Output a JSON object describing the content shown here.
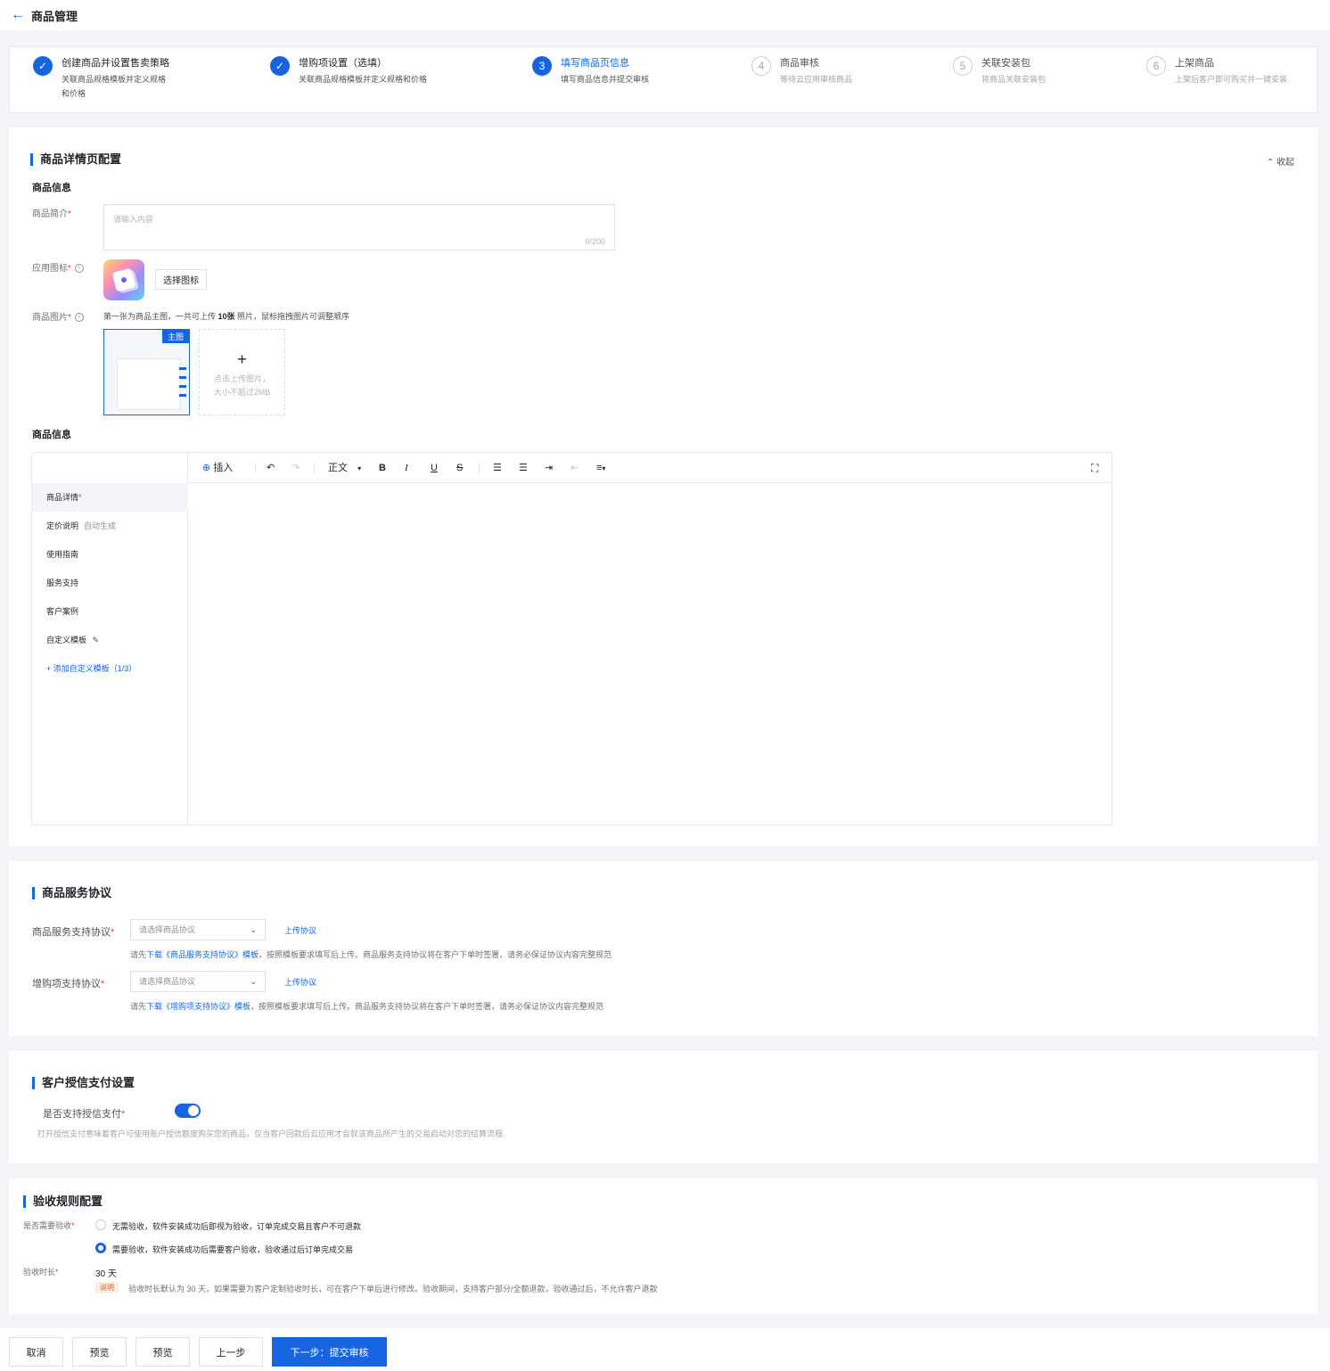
{
  "header": {
    "back_icon": "arrow-left-icon",
    "title": "商品管理"
  },
  "steps": [
    {
      "num": "",
      "name": "创建商品并设置售卖策略",
      "desc1": "关联商品规格模板并定义规格",
      "desc2": "和价格",
      "state": "done"
    },
    {
      "num": "",
      "name": "增购项设置（选填）",
      "desc1": "关联商品规格模板并定义规格和价格",
      "desc2": "",
      "state": "done"
    },
    {
      "num": "3",
      "name": "填写商品页信息",
      "desc1": "填写商品信息并提交审核",
      "desc2": "",
      "state": "active"
    },
    {
      "num": "4",
      "name": "商品审核",
      "desc1": "等待云应用审核商品",
      "desc2": "",
      "state": "todo"
    },
    {
      "num": "5",
      "name": "关联安装包",
      "desc1": "将商品关联安装包",
      "desc2": "",
      "state": "todo"
    },
    {
      "num": "6",
      "name": "上架商品",
      "desc1": "上架后客户即可购买并一键安装",
      "desc2": "",
      "state": "todo"
    }
  ],
  "detail": {
    "title": "商品详情页配置",
    "collapse": "收起",
    "info_title": "商品信息",
    "intro_label": "商品简介",
    "intro_placeholder": "请输入内容",
    "intro_count": "0/200",
    "icon_label": "应用图标",
    "choose_icon": "选择图标",
    "pic_label": "商品图片",
    "pic_hint_pre": "第一张为商品主图，一共可上传 ",
    "pic_hint_num": "10张",
    "pic_hint_post": " 照片，鼠标拖拽图片可调整顺序",
    "main_tag": "主图",
    "upload_plus": "+",
    "upload_line1": "点击上传图片，",
    "upload_line2": "大小不超过2MB",
    "info_title2": "商品信息"
  },
  "editor": {
    "insert": "插入",
    "text_style": "正文",
    "side": [
      {
        "label": "商品详情",
        "extra": "",
        "req": "*"
      },
      {
        "label": "定价说明",
        "extra": "自动生成",
        "req": ""
      },
      {
        "label": "使用指南",
        "extra": "",
        "req": ""
      },
      {
        "label": "服务支持",
        "extra": "",
        "req": ""
      },
      {
        "label": "客户案例",
        "extra": "",
        "req": ""
      },
      {
        "label": "自定义模板",
        "extra": "",
        "req": ""
      }
    ],
    "add_template": "+ 添加自定义模板（1/3）"
  },
  "agreement": {
    "title": "商品服务协议",
    "service_label": "商品服务支持协议",
    "service_placeholder": "请选择商品协议",
    "upload": "上传协议",
    "service_note_pre": "请先",
    "service_note_link": "下载《商品服务支持协议》模板",
    "service_note_post": "，按照模板要求填写后上传。商品服务支持协议将在客户下单时签署，请务必保证协议内容完整规范",
    "addon_label": "增购项支持协议",
    "addon_placeholder": "请选择商品协议",
    "addon_note_pre": "请先",
    "addon_note_link": "下载《增购项支持协议》模板",
    "addon_note_post": "，按照模板要求填写后上传。商品服务支持协议将在客户下单时签署，请务必保证协议内容完整规范"
  },
  "credit": {
    "title": "客户授信支付设置",
    "label": "是否支持授信支付",
    "enabled": true,
    "note": "打开授信支付意味着客户可使用账户授信额度购买您的商品，仅当客户回款后云应用才会就该商品所产生的交易启动对您的结算流程"
  },
  "acceptance": {
    "title": "验收规则配置",
    "need_label": "是否需要验收",
    "option1": "无需验收，软件安装成功后即视为验收，订单完成交易且客户不可退款",
    "option2": "需要验收，软件安装成功后需要客户验收，验收通过后订单完成交易",
    "selected": 2,
    "duration_label": "验收时长",
    "duration_value": "30 天",
    "badge": "说明",
    "duration_note": "验收时长默认为 30 天，如果需要为客户定制验收时长，可在客户下单后进行修改。验收期间，支持客户部分/全额退款，验收通过后，不允许客户退款"
  },
  "footer": {
    "cancel": "取消",
    "preview1": "预览",
    "preview2": "预览",
    "prev": "上一步",
    "next": "下一步：提交审核"
  },
  "colors": {
    "accent": "#1664e0",
    "required": "#e54545"
  }
}
